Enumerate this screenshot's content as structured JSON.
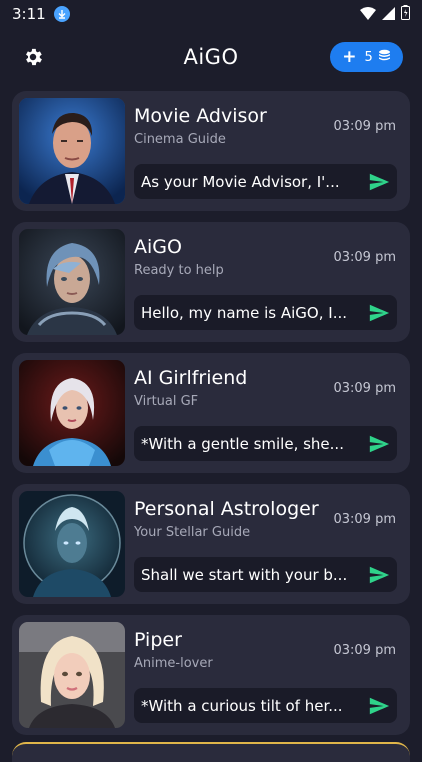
{
  "status": {
    "time": "3:11"
  },
  "header": {
    "title": "AiGO",
    "credits_count": "5"
  },
  "chats": [
    {
      "name": "Movie Advisor",
      "subtitle": "Cinema Guide",
      "time": "03:09 pm",
      "preview": "As your Movie Advisor, I'..."
    },
    {
      "name": "AiGO",
      "subtitle": "Ready to help",
      "time": "03:09 pm",
      "preview": "Hello, my name is AiGO, I..."
    },
    {
      "name": "AI Girlfriend",
      "subtitle": "Virtual GF",
      "time": "03:09 pm",
      "preview": "*With a gentle smile, she..."
    },
    {
      "name": "Personal Astrologer",
      "subtitle": "Your Stellar Guide",
      "time": "03:09 pm",
      "preview": "Shall we start with your b..."
    },
    {
      "name": "Piper",
      "subtitle": "Anime-lover",
      "time": "03:09 pm",
      "preview": "*With a curious tilt of her..."
    }
  ],
  "colors": {
    "background": "#1c1d2b",
    "card": "#2a2b3c",
    "accent_blue": "#1e7df0",
    "send_green": "#2fd38a"
  }
}
